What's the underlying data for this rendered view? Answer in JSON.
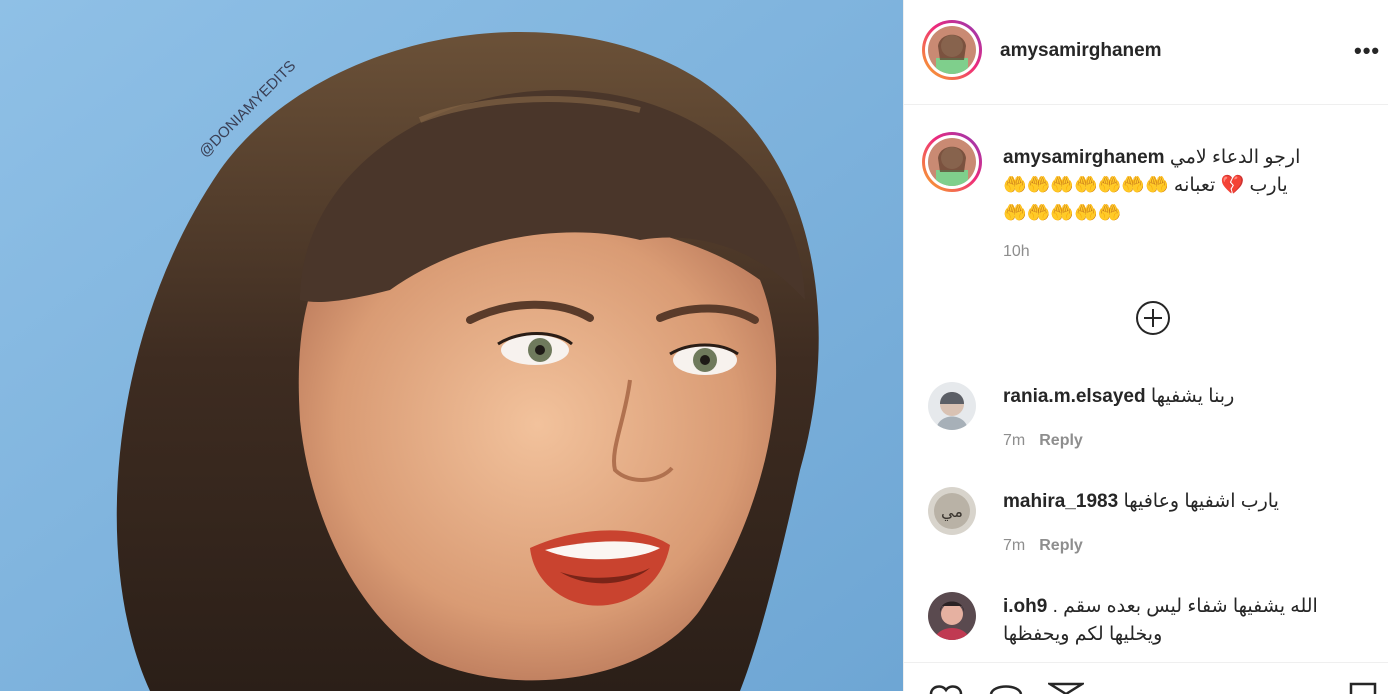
{
  "post": {
    "username": "amysamirghanem",
    "more_label": "•••",
    "watermark": "@DONIAMYEDITS"
  },
  "caption": {
    "username": "amysamirghanem",
    "line1": "ارجو الدعاء لامي",
    "line2": "يارب 💔 تعبانه 🤲🤲🤲🤲🤲🤲🤲",
    "line3": "🤲🤲🤲🤲🤲",
    "time": "10h"
  },
  "load_more": {
    "icon": "plus-circle-icon"
  },
  "comments": [
    {
      "username": "rania.m.elsayed",
      "text": "ربنا يشفيها",
      "time": "7m",
      "reply": "Reply"
    },
    {
      "username": "mahira_1983",
      "text": "يارب اشفيها وعافيها",
      "time": "7m",
      "reply": "Reply"
    },
    {
      "username": "i.oh9",
      "text": "الله يشفيها شفاء ليس بعده سقم .",
      "text2": "ويخليها لكم ويحفظها"
    }
  ],
  "actions": [
    "heart-icon",
    "comment-icon",
    "share-icon",
    "bookmark-icon"
  ]
}
